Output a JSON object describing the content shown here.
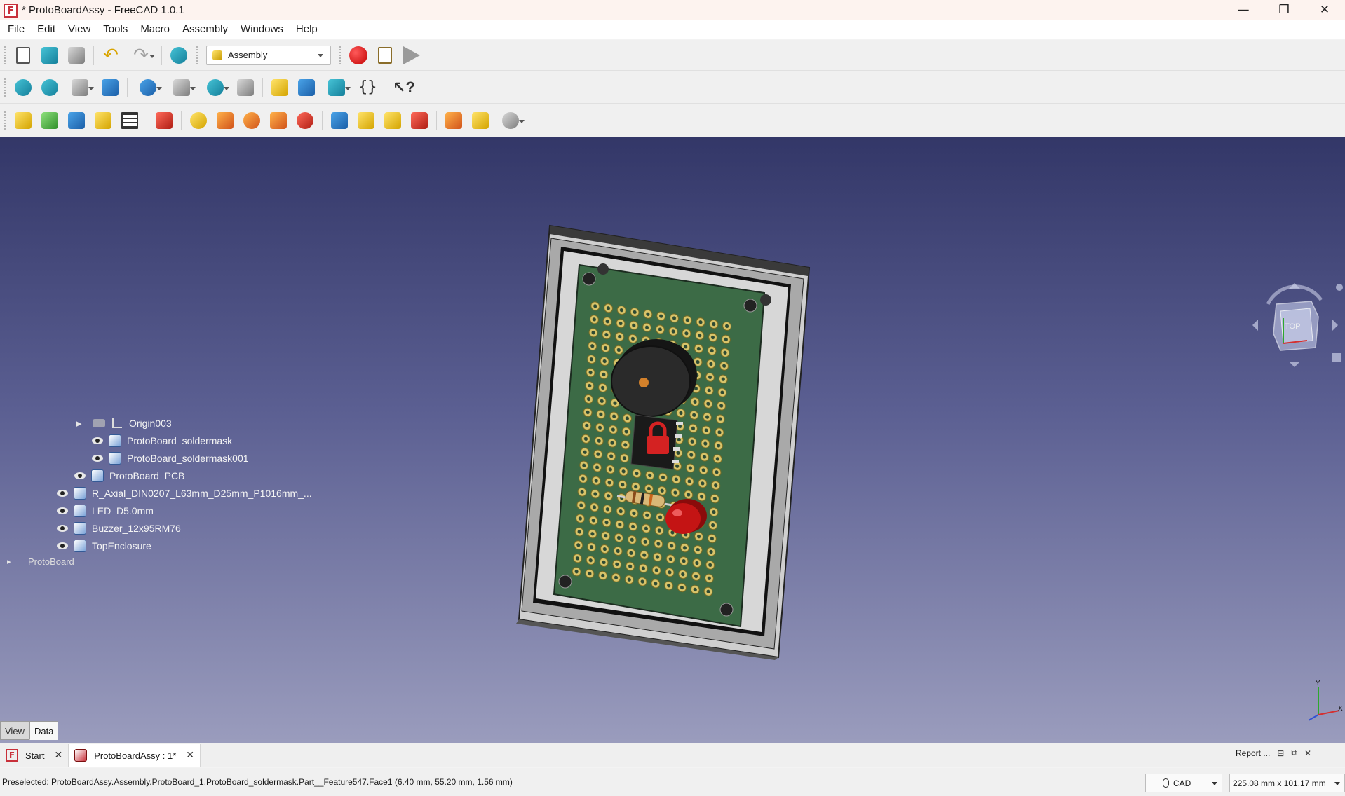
{
  "window": {
    "title": "* ProtoBoardAssy - FreeCAD 1.0.1",
    "app_icon_letter": "F",
    "controls": {
      "minimize": "—",
      "restore": "❐",
      "close": "✕"
    }
  },
  "menu": [
    "File",
    "Edit",
    "View",
    "Tools",
    "Macro",
    "Assembly",
    "Windows",
    "Help"
  ],
  "toolbar": {
    "workbench": "Assembly"
  },
  "tree": {
    "rows": [
      {
        "label": "Origin003",
        "kind": "origin"
      },
      {
        "label": "ProtoBoard_soldermask",
        "kind": "part"
      },
      {
        "label": "ProtoBoard_soldermask001",
        "kind": "part"
      },
      {
        "label": "ProtoBoard_PCB",
        "kind": "part"
      },
      {
        "label": "R_Axial_DIN0207_L63mm_D25mm_P1016mm_...",
        "kind": "part"
      },
      {
        "label": "LED_D5.0mm",
        "kind": "part"
      },
      {
        "label": "Buzzer_12x95RM76",
        "kind": "part"
      },
      {
        "label": "TopEnclosure",
        "kind": "part"
      },
      {
        "label": "ProtoBoard",
        "kind": "partial"
      }
    ]
  },
  "panel_tabs": {
    "view": "View",
    "data": "Data",
    "active": "data"
  },
  "navcube": {
    "face": "TOP"
  },
  "axis_triad": {
    "x": "X",
    "y": "Y"
  },
  "doc_tabs": [
    {
      "label": "Start",
      "close": "✕",
      "active": false
    },
    {
      "label": "ProtoBoardAssy : 1*",
      "close": "✕",
      "active": true
    }
  ],
  "report": {
    "label": "Report ...",
    "close": "✕"
  },
  "status": {
    "preselected": "Preselected: ProtoBoardAssy.Assembly.ProtoBoard_1.ProtoBoard_soldermask.Part__Feature547.Face1 (6.40 mm, 55.20 mm, 1.56 mm)",
    "nav_style": "CAD",
    "dimensions": "225.08 mm x 101.17 mm"
  },
  "colors": {
    "viewport_top": "#333768",
    "viewport_bottom": "#9a9cbd",
    "pcb": "#3c6b46",
    "enclosure": "#cfcfcf",
    "led": "#c41414",
    "lock": "#d42222"
  }
}
